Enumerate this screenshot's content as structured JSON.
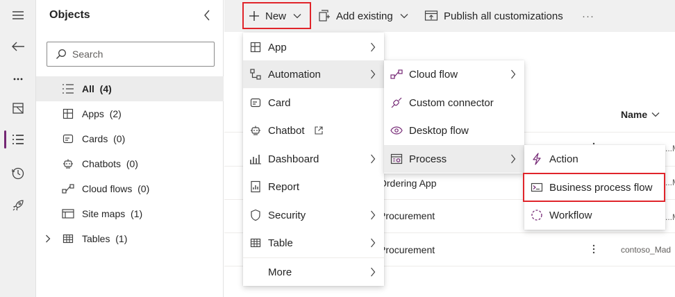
{
  "objects_pane": {
    "title": "Objects",
    "search_placeholder": "Search",
    "items": [
      {
        "label": "All  (4)",
        "icon": "list-icon"
      },
      {
        "label": "Apps  (2)",
        "icon": "apps-icon"
      },
      {
        "label": "Cards  (0)",
        "icon": "card-icon"
      },
      {
        "label": "Chatbots  (0)",
        "icon": "chatbot-icon"
      },
      {
        "label": "Cloud flows  (0)",
        "icon": "flow-icon"
      },
      {
        "label": "Site maps  (1)",
        "icon": "sitemap-icon"
      },
      {
        "label": "Tables  (1)",
        "icon": "table-icon"
      }
    ]
  },
  "command_bar": {
    "new_label": "New",
    "add_existing_label": "Add existing",
    "publish_label": "Publish all customizations",
    "more_label": "···"
  },
  "main_list": {
    "column_header": "Name",
    "rows": [
      {
        "name": "",
        "owner": "...Mad"
      },
      {
        "name": "Ordering App",
        "owner": "...Mad"
      },
      {
        "name": "Procurement",
        "owner": "...Mad"
      },
      {
        "name": "Procurement",
        "owner": "contoso_Mad"
      }
    ]
  },
  "new_menu": {
    "items": [
      {
        "label": "App",
        "icon": "app-icon",
        "submenu": true
      },
      {
        "label": "Automation",
        "icon": "automation-icon",
        "submenu": true,
        "active": true
      },
      {
        "label": "Card",
        "icon": "card-icon",
        "submenu": false
      },
      {
        "label": "Chatbot",
        "icon": "chatbot-icon",
        "submenu": false,
        "external": true
      },
      {
        "label": "Dashboard",
        "icon": "dashboard-icon",
        "submenu": true
      },
      {
        "label": "Report",
        "icon": "report-icon",
        "submenu": false
      },
      {
        "label": "Security",
        "icon": "shield-icon",
        "submenu": true
      },
      {
        "label": "Table",
        "icon": "table-icon",
        "submenu": true
      },
      {
        "label": "More",
        "icon": "",
        "submenu": true
      }
    ]
  },
  "automation_menu": {
    "items": [
      {
        "label": "Cloud flow",
        "icon": "cloud-flow-icon",
        "submenu": true
      },
      {
        "label": "Custom connector",
        "icon": "connector-icon",
        "submenu": false
      },
      {
        "label": "Desktop flow",
        "icon": "desktop-flow-icon",
        "submenu": false
      },
      {
        "label": "Process",
        "icon": "process-icon",
        "submenu": true,
        "active": true
      }
    ]
  },
  "process_menu": {
    "items": [
      {
        "label": "Action",
        "icon": "action-icon"
      },
      {
        "label": "Business process flow",
        "icon": "business-process-flow-icon",
        "highlighted": true
      },
      {
        "label": "Workflow",
        "icon": "workflow-icon"
      }
    ]
  },
  "colors": {
    "accent": "#742774",
    "highlight_border": "#e0242a",
    "menu_active_bg": "#ececec"
  }
}
